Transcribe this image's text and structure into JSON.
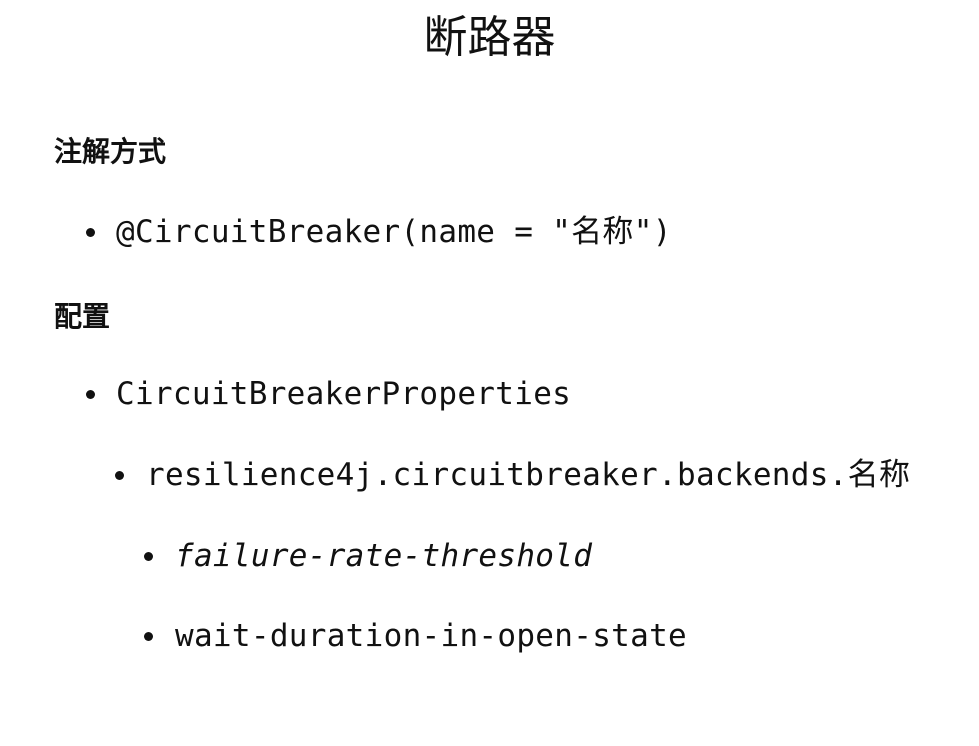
{
  "slide": {
    "title": "断路器",
    "sections": [
      {
        "heading": "注解方式",
        "items": [
          {
            "text": "@CircuitBreaker(name = \"名称\")"
          }
        ]
      },
      {
        "heading": "配置",
        "items": [
          {
            "text": "CircuitBreakerProperties"
          },
          {
            "text": "resilience4j.circuitbreaker.backends.名称"
          },
          {
            "text": "failure-rate-threshold"
          },
          {
            "text": "wait-duration-in-open-state"
          }
        ]
      }
    ]
  }
}
